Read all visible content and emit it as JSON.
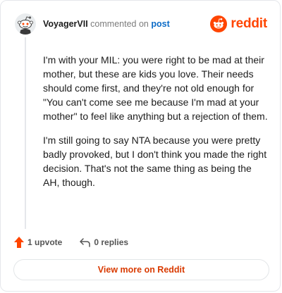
{
  "header": {
    "username": "VoyagerVII",
    "verb": "commented on",
    "post_link": "post",
    "brand": "reddit"
  },
  "colors": {
    "brand": "#ff4500",
    "link": "#0b6bc7",
    "upvote": "#ff4500",
    "cta": "#d93a00"
  },
  "comment": {
    "paragraphs": [
      "I'm with your MIL: you were right to be mad at their mother, but these are kids you love. Their needs should come first, and they're not old enough for \"You can't come see me because I'm mad at your mother\" to feel like anything but a rejection of them.",
      "I'm still going to say NTA because you were pretty badly provoked, but I don't think you made the right decision. That's not the same thing as being the AH, though."
    ]
  },
  "actions": {
    "upvotes": "1 upvote",
    "replies": "0 replies",
    "upvote_icon": "upvote-arrow-icon",
    "reply_icon": "reply-arrow-icon"
  },
  "cta": {
    "label": "View more on Reddit"
  }
}
